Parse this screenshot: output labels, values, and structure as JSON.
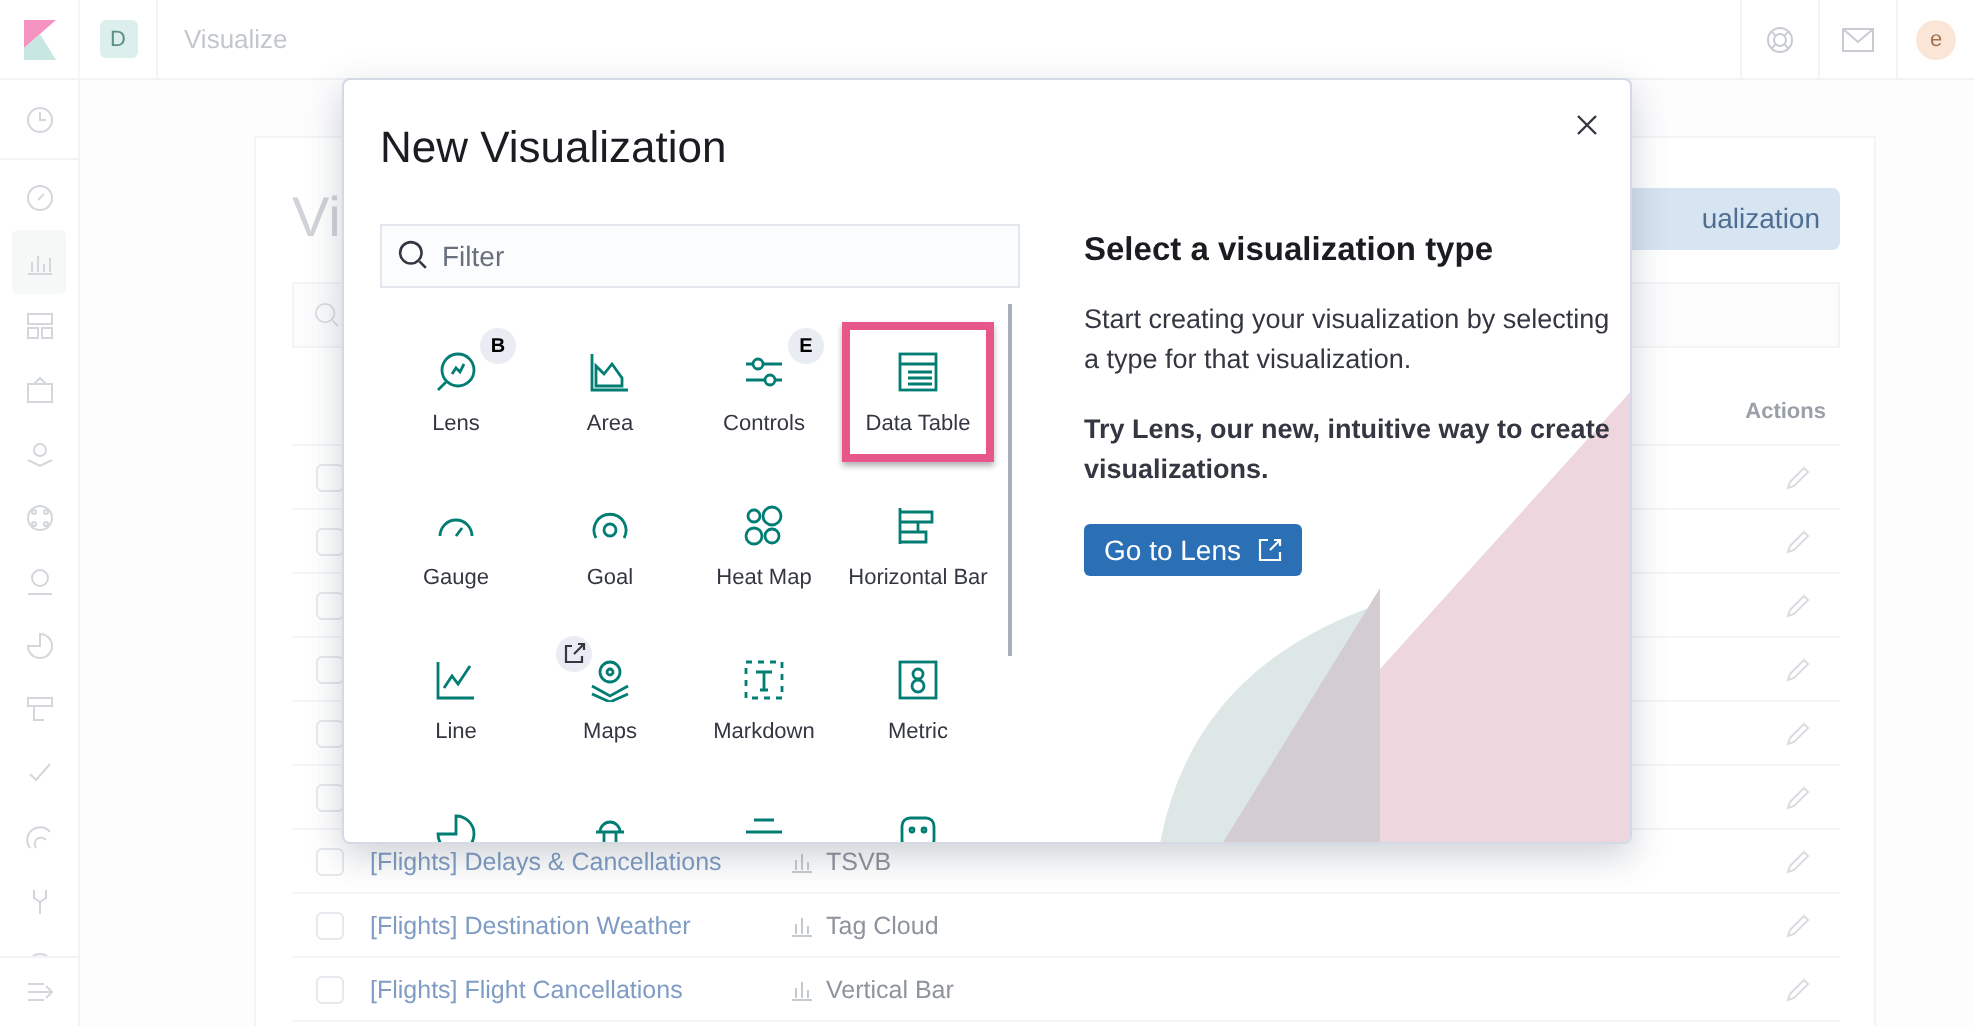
{
  "header": {
    "space_avatar": "D",
    "breadcrumb": "Visualize",
    "user_avatar": "e"
  },
  "page": {
    "title": "Vi",
    "create_button": "ualization",
    "actions_header": "Actions",
    "rows": [
      {
        "checked": false
      },
      {
        "checked": false
      },
      {
        "checked": false
      },
      {
        "checked": false
      },
      {
        "checked": false
      },
      {
        "checked": false
      },
      {
        "checked": false,
        "name": "[Flights] Delays & Cancellations",
        "type": "TSVB"
      },
      {
        "checked": false,
        "name": "[Flights] Destination Weather",
        "type": "Tag Cloud"
      },
      {
        "checked": false,
        "name": "[Flights] Flight Cancellations",
        "type": "Vertical Bar"
      }
    ]
  },
  "modal": {
    "title": "New Visualization",
    "filter": {
      "placeholder": "Filter"
    },
    "types": [
      {
        "label": "Lens",
        "badge": "B",
        "selected": false
      },
      {
        "label": "Area",
        "selected": false
      },
      {
        "label": "Controls",
        "badge": "E",
        "selected": false
      },
      {
        "label": "Data Table",
        "selected": true
      },
      {
        "label": "Gauge",
        "selected": false
      },
      {
        "label": "Goal",
        "selected": false
      },
      {
        "label": "Heat Map",
        "selected": false
      },
      {
        "label": "Horizontal Bar",
        "selected": false
      },
      {
        "label": "Line",
        "selected": false
      },
      {
        "label": "Maps",
        "external": true,
        "selected": false
      },
      {
        "label": "Markdown",
        "selected": false
      },
      {
        "label": "Metric",
        "selected": false
      },
      {
        "selected": false
      },
      {
        "selected": false
      },
      {
        "selected": false
      },
      {
        "selected": false
      }
    ],
    "side": {
      "heading": "Select a visualization type",
      "description": "Start creating your visualization by selecting a type for that visualization.",
      "promo": "Try Lens, our new, intuitive way to create visualizations.",
      "button": "Go to Lens"
    }
  }
}
